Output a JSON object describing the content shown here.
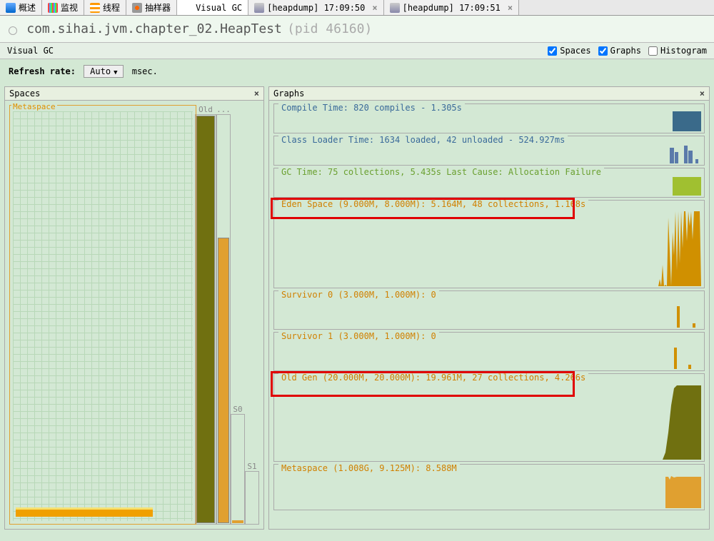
{
  "tabs": {
    "overview": "概述",
    "monitor": "监视",
    "threads": "线程",
    "sampler": "抽样器",
    "visualgc": "Visual GC",
    "heapdump1": "[heapdump] 17:09:50",
    "heapdump2": "[heapdump] 17:09:51"
  },
  "title": {
    "main": "com.sihai.jvm.chapter_02.HeapTest",
    "pid": "(pid 46160)"
  },
  "sub_header": {
    "label": "Visual GC",
    "chk_spaces": "Spaces",
    "chk_graphs": "Graphs",
    "chk_hist": "Histogram"
  },
  "refresh": {
    "label": "Refresh rate:",
    "value": "Auto",
    "unit": "msec."
  },
  "panels": {
    "spaces_title": "Spaces",
    "graphs_title": "Graphs",
    "meta_label": "Metaspace",
    "old_label": "Old",
    "eden_label": "...",
    "s0_label": "S0",
    "s1_label": "S1"
  },
  "graphs": {
    "compile": "Compile Time: 820 compiles - 1.305s",
    "classloader": "Class Loader Time: 1634 loaded, 42 unloaded - 524.927ms",
    "gc": "GC Time: 75 collections, 5.435s  Last Cause: Allocation Failure",
    "eden": "Eden Space (9.000M, 8.000M): 5.164M, 48 collections, 1.168s",
    "s0": "Survivor 0 (3.000M, 1.000M): 0",
    "s1": "Survivor 1 (3.000M, 1.000M): 0",
    "oldgen": "Old Gen (20.000M, 20.000M): 19.961M, 27 collections, 4.266s",
    "metaspace": "Metaspace (1.008G, 9.125M): 8.588M"
  },
  "chart_data": [
    {
      "type": "area",
      "name": "compile",
      "color": "#3a6a8a",
      "values": [
        28,
        28,
        28,
        28
      ]
    },
    {
      "type": "bar",
      "name": "classloader",
      "color": "#5a7aaa",
      "values": [
        22,
        16,
        0,
        25,
        18,
        0,
        4
      ]
    },
    {
      "type": "area",
      "name": "gc",
      "color": "#a0c030",
      "values": [
        26,
        26,
        26,
        26
      ]
    },
    {
      "type": "bar",
      "name": "eden",
      "color": "#d09000",
      "values": [
        0,
        10,
        0,
        30,
        0,
        2,
        0,
        90,
        50,
        0,
        70,
        40,
        98,
        20,
        98,
        30,
        98,
        50,
        98,
        98,
        60,
        98,
        80
      ]
    },
    {
      "type": "bar",
      "name": "s0",
      "color": "#d09000",
      "values": [
        0,
        0,
        28,
        0,
        0,
        2
      ]
    },
    {
      "type": "bar",
      "name": "s1",
      "color": "#d09000",
      "values": [
        0,
        28,
        0,
        0,
        2,
        0
      ]
    },
    {
      "type": "area",
      "name": "oldgen",
      "color": "#707010",
      "values": [
        0,
        10,
        35,
        70,
        95,
        98,
        98,
        98,
        98,
        98
      ]
    },
    {
      "type": "area",
      "name": "metaspace",
      "color": "#e0a030",
      "values": [
        95,
        95,
        93,
        96,
        95,
        95,
        95,
        95,
        95,
        95
      ]
    }
  ]
}
